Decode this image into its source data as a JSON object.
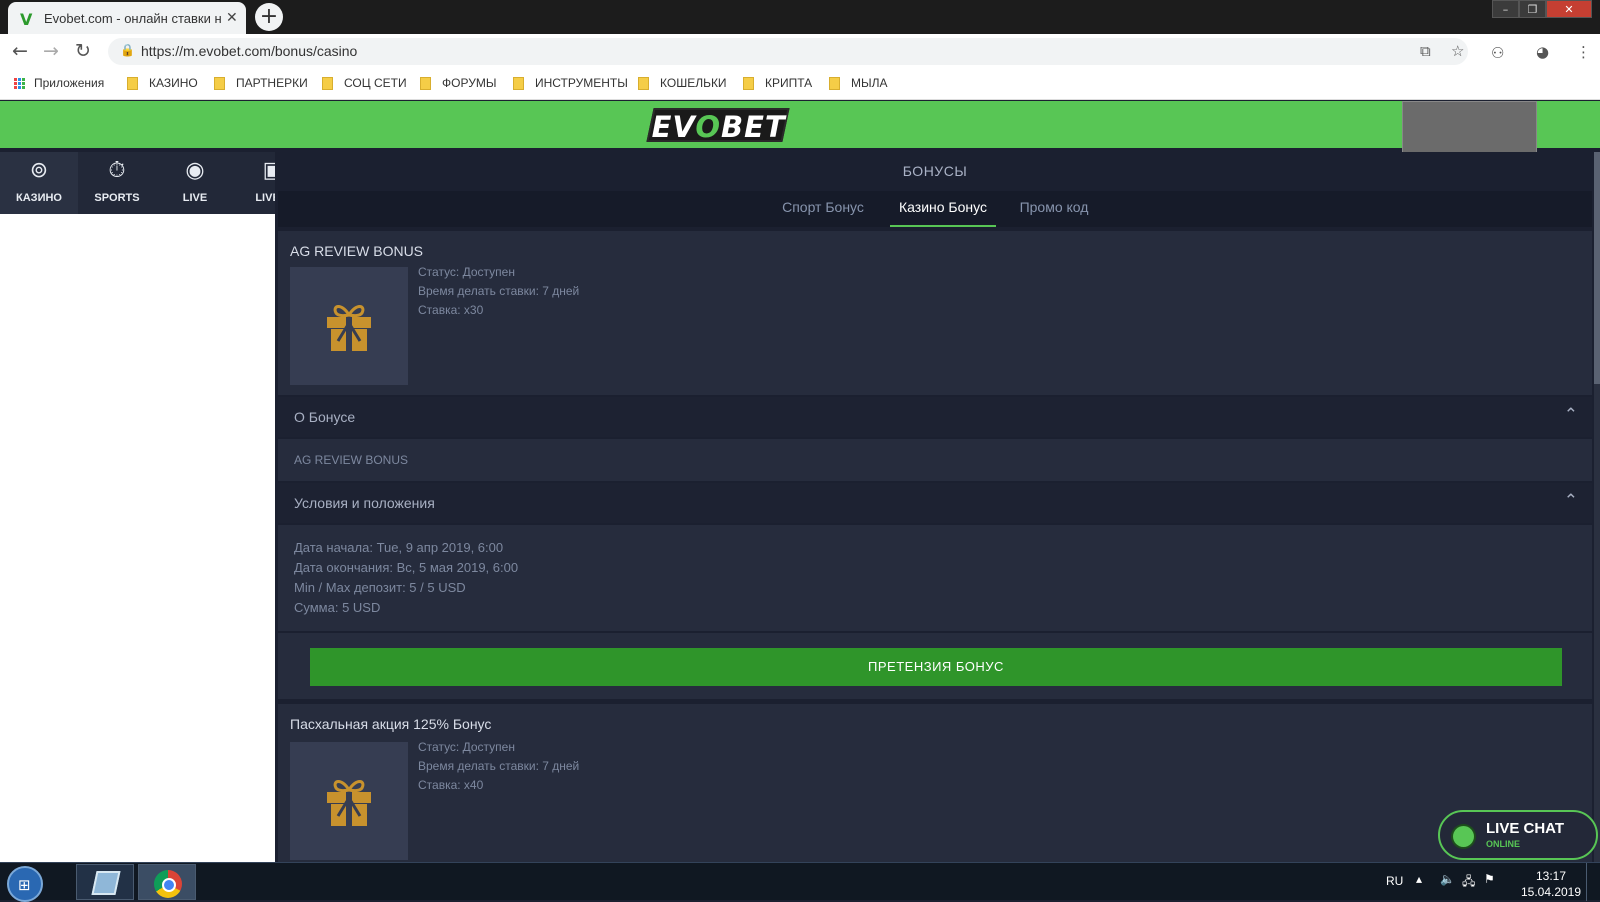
{
  "browser": {
    "tab_title": "Evobet.com - онлайн ставки на спорт",
    "url": "https://m.evobet.com/bonus/casino",
    "bookmarks": [
      "Приложения",
      "КАЗИНО",
      "ПАРТНЕРКИ",
      "СОЦ СЕТИ",
      "ФОРУМЫ",
      "ИНСТРУМЕНТЫ",
      "КОШЕЛЬКИ",
      "КРИПТА",
      "МЫЛА"
    ]
  },
  "header": {
    "logo_left": "EV",
    "logo_o": "O",
    "logo_right": "BET"
  },
  "nav": [
    {
      "label": "КАЗИНО",
      "icon": "casino-chip-icon"
    },
    {
      "label": "SPORTS",
      "icon": "stopwatch-icon"
    },
    {
      "label": "LIVE",
      "icon": "live-record-icon"
    },
    {
      "label": "LIVE Д",
      "icon": "live-dealer-icon"
    }
  ],
  "page": {
    "title": "БОНУСЫ",
    "tabs": [
      "Спорт Бонус",
      "Казино Бонус",
      "Промо код"
    ],
    "active_tab": "Казино Бонус"
  },
  "bonuses": [
    {
      "title": "AG REVIEW BONUS",
      "status": "Статус: Доступен",
      "time": "Время делать ставки: 7 дней",
      "wager": "Ставка: x30",
      "about_heading": "О Бонусе",
      "about_text": "AG REVIEW BONUS",
      "terms_heading": "Условия и положения",
      "terms": [
        "Дата начала: Tue, 9 апр 2019, 6:00",
        "Дата окончания: Вс, 5 мая 2019, 6:00",
        "Min / Max депозит: 5 / 5 USD",
        "Сумма: 5 USD"
      ],
      "claim_button": "ПРЕТЕНЗИЯ БОНУС"
    },
    {
      "title": "Пасхальная акция 125% Бонус",
      "status": "Статус: Доступен",
      "time": "Время делать ставки: 7 дней",
      "wager": "Ставка: x40"
    }
  ],
  "livechat": {
    "title": "LIVE CHAT",
    "status": "ONLINE"
  },
  "taskbar": {
    "language": "RU",
    "time": "13:17",
    "date": "15.04.2019"
  },
  "colors": {
    "brand_green": "#58c655",
    "claim_green": "#2f952a",
    "bg_dark": "#1b2030",
    "gift_gold": "#c8922d"
  }
}
